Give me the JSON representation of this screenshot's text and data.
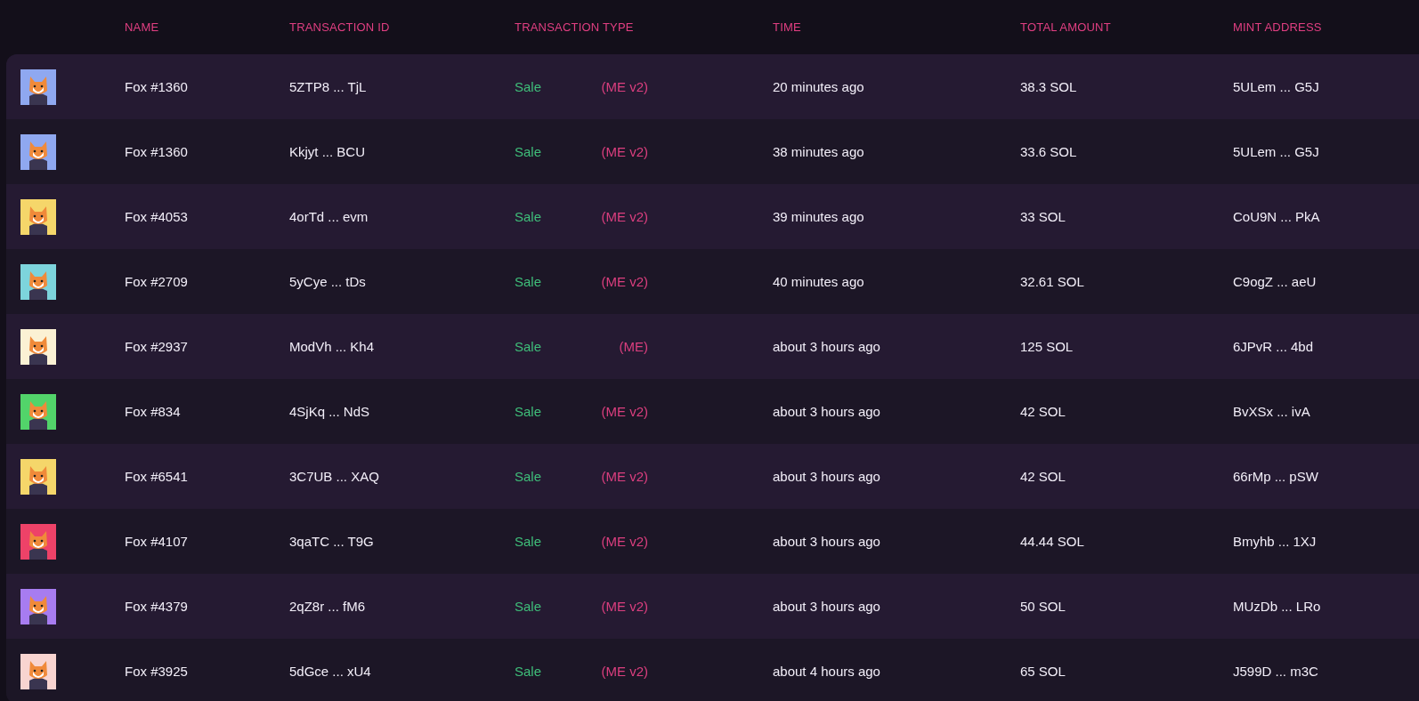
{
  "columns": [
    "NAME",
    "TRANSACTION ID",
    "TRANSACTION TYPE",
    "TIME",
    "TOTAL AMOUNT",
    "MINT ADDRESS"
  ],
  "rows": [
    {
      "color": "#8fa8f0",
      "name": "Fox #1360",
      "transaction_id": "5ZTP8 ... TjL",
      "type": "Sale",
      "marketplace": "(ME v2)",
      "time": "20 minutes ago",
      "amount": "38.3 SOL",
      "mint": "5ULem ... G5J"
    },
    {
      "color": "#8fa8f0",
      "name": "Fox #1360",
      "transaction_id": "Kkjyt ... BCU",
      "type": "Sale",
      "marketplace": "(ME v2)",
      "time": "38 minutes ago",
      "amount": "33.6 SOL",
      "mint": "5ULem ... G5J"
    },
    {
      "color": "#f5d66a",
      "name": "Fox #4053",
      "transaction_id": "4orTd ... evm",
      "type": "Sale",
      "marketplace": "(ME v2)",
      "time": "39 minutes ago",
      "amount": "33 SOL",
      "mint": "CoU9N ... PkA"
    },
    {
      "color": "#7dd4dc",
      "name": "Fox #2709",
      "transaction_id": "5yCye ... tDs",
      "type": "Sale",
      "marketplace": "(ME v2)",
      "time": "40 minutes ago",
      "amount": "32.61 SOL",
      "mint": "C9ogZ ... aeU"
    },
    {
      "color": "#fbf1d4",
      "name": "Fox #2937",
      "transaction_id": "ModVh ... Kh4",
      "type": "Sale",
      "marketplace": "(ME)",
      "time": "about 3 hours ago",
      "amount": "125 SOL",
      "mint": "6JPvR ... 4bd"
    },
    {
      "color": "#52d46a",
      "name": "Fox #834",
      "transaction_id": "4SjKq ... NdS",
      "type": "Sale",
      "marketplace": "(ME v2)",
      "time": "about 3 hours ago",
      "amount": "42 SOL",
      "mint": "BvXSx ... ivA"
    },
    {
      "color": "#f5d66a",
      "name": "Fox #6541",
      "transaction_id": "3C7UB ... XAQ",
      "type": "Sale",
      "marketplace": "(ME v2)",
      "time": "about 3 hours ago",
      "amount": "42 SOL",
      "mint": "66rMp ... pSW"
    },
    {
      "color": "#ee4268",
      "name": "Fox #4107",
      "transaction_id": "3qaTC ... T9G",
      "type": "Sale",
      "marketplace": "(ME v2)",
      "time": "about 3 hours ago",
      "amount": "44.44 SOL",
      "mint": "Bmyhb ... 1XJ"
    },
    {
      "color": "#a77cf0",
      "name": "Fox #4379",
      "transaction_id": "2qZ8r ... fM6",
      "type": "Sale",
      "marketplace": "(ME v2)",
      "time": "about 3 hours ago",
      "amount": "50 SOL",
      "mint": "MUzDb ... LRo"
    },
    {
      "color": "#f8d4d0",
      "name": "Fox #3925",
      "transaction_id": "5dGce ... xU4",
      "type": "Sale",
      "marketplace": "(ME v2)",
      "time": "about 4 hours ago",
      "amount": "65 SOL",
      "mint": "J599D ... m3C"
    }
  ]
}
